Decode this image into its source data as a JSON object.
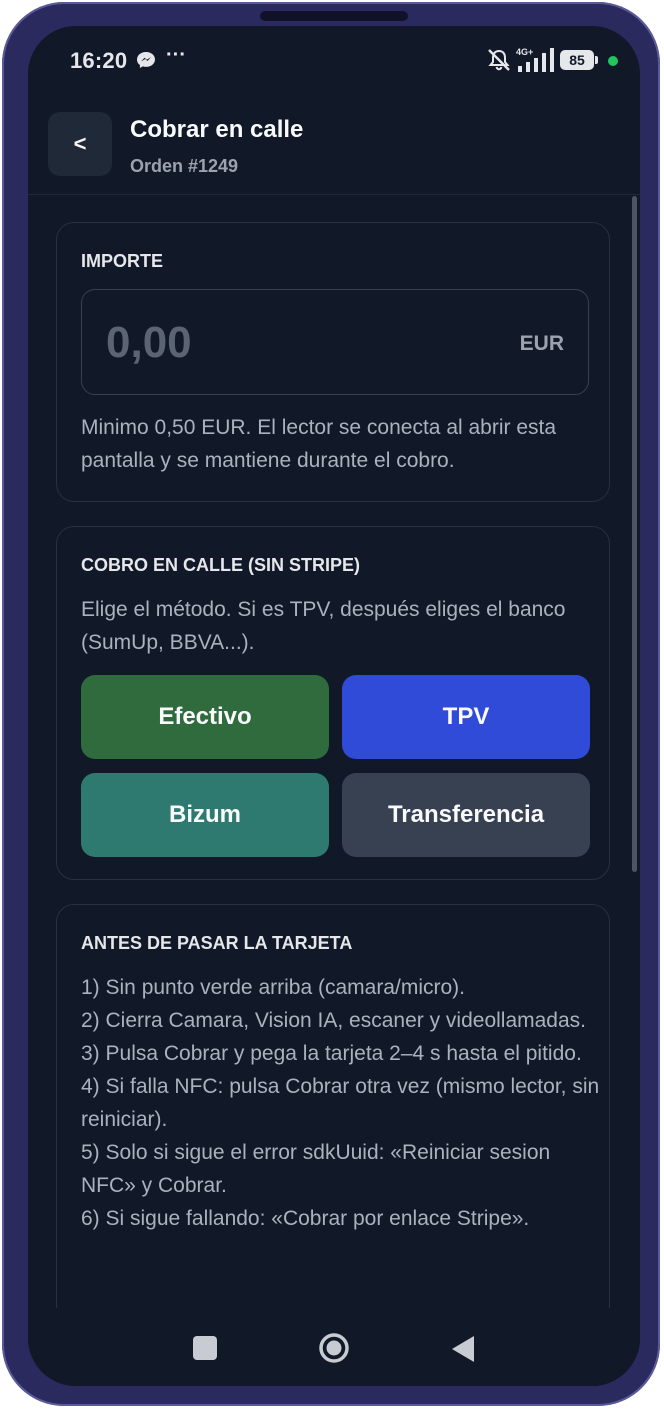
{
  "status_bar": {
    "time": "16:20",
    "dots": "···",
    "network": "4G+",
    "battery": "85"
  },
  "header": {
    "back_label": "<",
    "title": "Cobrar en calle",
    "subtitle": "Orden #1249"
  },
  "importe": {
    "label": "IMPORTE",
    "amount_placeholder": "0,00",
    "currency": "EUR",
    "help": "Minimo 0,50 EUR. El lector se conecta al abrir esta pantalla y se mantiene durante el cobro."
  },
  "cobro": {
    "label": "COBRO EN CALLE (SIN STRIPE)",
    "help": "Elige el método. Si es TPV, después eliges el banco (SumUp, BBVA...).",
    "methods": [
      {
        "label": "Efectivo",
        "color": "#2f6b3c"
      },
      {
        "label": "TPV",
        "color": "#2f4bd8"
      },
      {
        "label": "Bizum",
        "color": "#2f7a70"
      },
      {
        "label": "Transferencia",
        "color": "#374151"
      }
    ]
  },
  "antes": {
    "label": "ANTES DE PASAR LA TARJETA",
    "steps": [
      "1) Sin punto verde arriba (camara/micro).",
      "2) Cierra Camara, Vision IA, escaner y videollamadas.",
      "3) Pulsa Cobrar y pega la tarjeta 2–4 s hasta el pitido.",
      "4) Si falla NFC: pulsa Cobrar otra vez (mismo lector, sin reiniciar).",
      "5) Solo si sigue el error sdkUuid: «Reiniciar sesion NFC» y Cobrar.",
      "6) Si sigue fallando: «Cobrar por enlace Stripe»."
    ]
  },
  "colors": {
    "background": "#111827",
    "accent_green_dot": "#22c55e"
  },
  "icons": {
    "message": "messenger-icon",
    "mute": "bell-off-icon",
    "nav_recents": "square-icon",
    "nav_home": "circle-icon",
    "nav_back": "triangle-back-icon"
  }
}
